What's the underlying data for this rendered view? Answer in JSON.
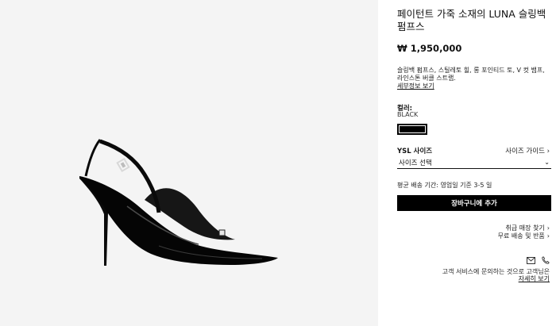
{
  "product": {
    "title": "페이턴트 가죽 소재의 LUNA 슬링백 펌프스",
    "price": "₩ 1,950,000",
    "description": "슬링백 펌프스, 스틸레토 힐, 롱 포인티드 토, V 컷 뱀프, 라인스톤 버클 스트랩.",
    "details_link": "세부정보 보기",
    "image_icon": "slingback-pump-shoe-image"
  },
  "color": {
    "label": "컬러:",
    "value": "BLACK",
    "swatch_color": "#000000"
  },
  "size": {
    "label": "YSL 사이즈",
    "guide": "사이즈 가이드",
    "select_value": "사이즈 선택"
  },
  "delivery": {
    "text": "평균 배송 기간: 영업일 기준 3-5 일"
  },
  "cart": {
    "button_label": "장바구니에 추가",
    "button_color": "#000000"
  },
  "links": {
    "store": "취급 매장 찾기",
    "returns": "무료 배송 및 반품"
  },
  "contact": {
    "text": "고객 서비스에 문의하는 것으로 고객님은",
    "link": "자세히 보기",
    "icons": [
      "mail-icon",
      "phone-icon"
    ]
  },
  "background_color": "#f4f4f4"
}
